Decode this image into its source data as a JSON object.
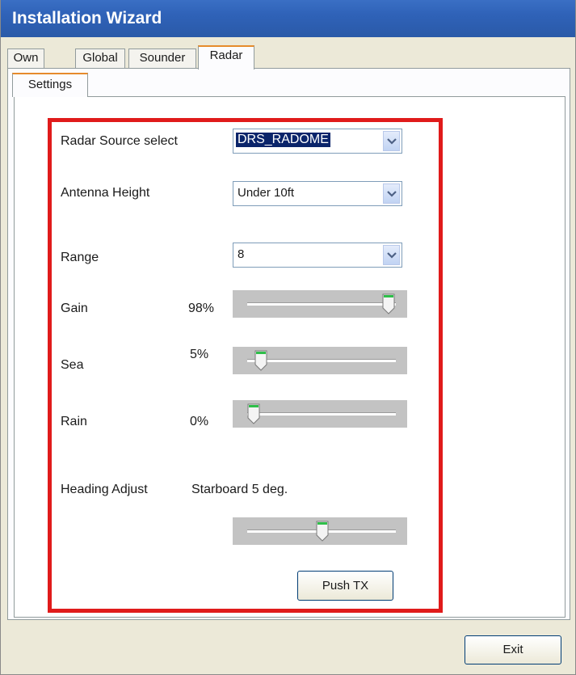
{
  "window": {
    "title": "Installation Wizard"
  },
  "tabs": [
    {
      "label": "Own",
      "active": false
    },
    {
      "label": "Global",
      "active": false
    },
    {
      "label": "Sounder",
      "active": false
    },
    {
      "label": "Radar",
      "active": true
    }
  ],
  "subtab": {
    "label": "Settings"
  },
  "settings": {
    "radar_source": {
      "label": "Radar Source select",
      "value": "DRS_RADOME"
    },
    "antenna_height": {
      "label": "Antenna Height",
      "value": "Under 10ft"
    },
    "range": {
      "label": "Range",
      "value": "8"
    },
    "gain": {
      "label": "Gain",
      "value_text": "98%",
      "value": 0.98
    },
    "sea": {
      "label": "Sea",
      "value_text": "5%",
      "value": 0.05
    },
    "rain": {
      "label": "Rain",
      "value_text": "0%",
      "value": 0.0
    },
    "heading_adjust": {
      "label": "Heading Adjust",
      "value_text": "Starboard 5 deg.",
      "value": 0.5
    }
  },
  "buttons": {
    "push_tx": "Push TX",
    "exit": "Exit"
  },
  "colors": {
    "highlight_frame": "#e01b1b",
    "titlebar": "#2f62b8",
    "selection": "#0a246a"
  }
}
